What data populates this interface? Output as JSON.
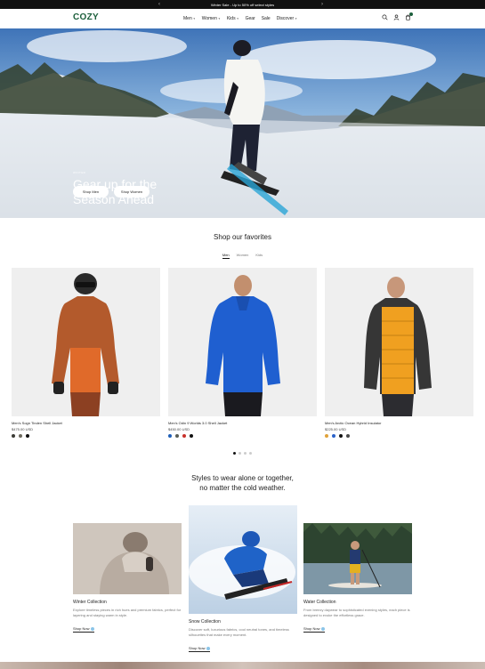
{
  "announcement": {
    "text": "Winter Sale - Up to 50% off select styles",
    "prev": "‹",
    "next": "›"
  },
  "header": {
    "logo": "COZY",
    "nav": [
      {
        "label": "Men",
        "chevron": true
      },
      {
        "label": "Women",
        "chevron": true
      },
      {
        "label": "Kids",
        "chevron": true
      },
      {
        "label": "Gear",
        "chevron": false
      },
      {
        "label": "Sale",
        "chevron": false
      },
      {
        "label": "Discover",
        "chevron": true
      }
    ],
    "icons": [
      "search-icon",
      "account-icon",
      "cart-icon"
    ]
  },
  "hero": {
    "eyebrow": "WINTER",
    "title": "Gear up for the Season Ahead",
    "buttons": [
      "Shop Men",
      "Shop Women"
    ]
  },
  "favorites": {
    "title": "Shop our favorites",
    "tabs": [
      "Men",
      "Women",
      "Kids"
    ],
    "active_tab": "Men",
    "products": [
      {
        "name": "Men's Sogn Tinden Shell Jacket",
        "price": "$475.00 USD",
        "swatches": [
          "#3b3b35",
          "#6d6a5e",
          "#111111"
        ]
      },
      {
        "name": "Men's Odin 9 Worlds 3.0 Shell Jacket",
        "price": "$450.00 USD",
        "swatches": [
          "#1f5fb8",
          "#5a5e55",
          "#c8312a",
          "#111111"
        ]
      },
      {
        "name": "Men's Arctic Ocean Hybrid Insulator",
        "price": "$225.00 USD",
        "swatches": [
          "#e0a23a",
          "#2a62c9",
          "#111111",
          "#4a4a4a"
        ]
      }
    ]
  },
  "styles": {
    "title_line1": "Styles to wear alone or together,",
    "title_line2": "no matter the cold weather.",
    "cards": [
      {
        "title": "Winter Collection",
        "desc": "Explore timeless pieces in rich hues and premium fabrics, perfect for layering and staying warm in style.",
        "link": "Shop Now"
      },
      {
        "title": "Snow Collection",
        "desc": "Discover soft, luxurious fabrics, cool neutral tones, and timeless silhouettes that make every moment.",
        "link": "Shop Now"
      },
      {
        "title": "Water Collection",
        "desc": "From breezy daywear to sophisticated evening styles, each piece is designed to evoke the effortless grace.",
        "link": "Shop Now"
      }
    ]
  },
  "colors": {
    "brand": "#1b5e3b",
    "accent_dot": "#8cc5e8"
  }
}
